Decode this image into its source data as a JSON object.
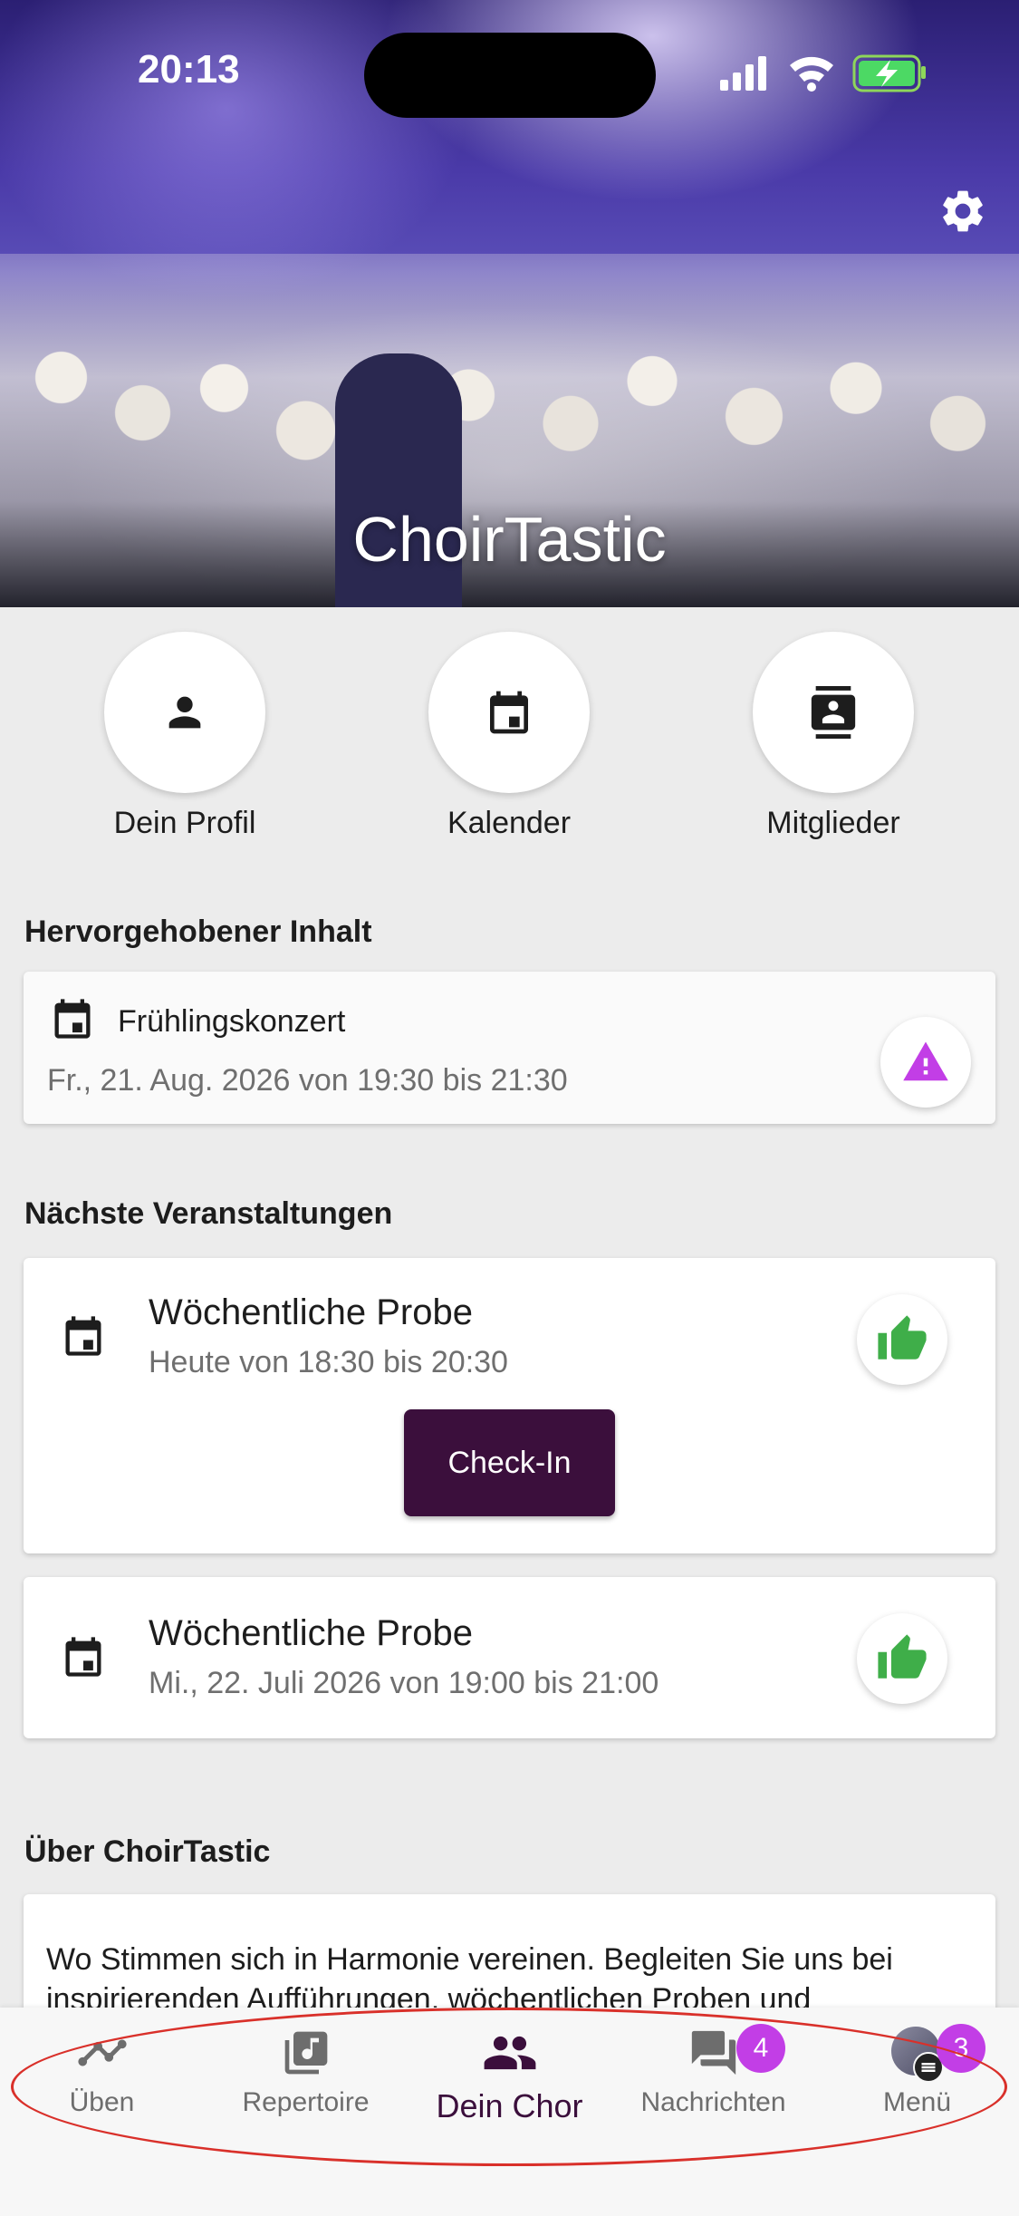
{
  "status_bar": {
    "time": "20:13"
  },
  "header": {
    "title": "ChoirTastic",
    "settings_icon": "gear-icon"
  },
  "quick_actions": [
    {
      "label": "Dein Profil",
      "icon": "person-icon"
    },
    {
      "label": "Kalender",
      "icon": "calendar-icon"
    },
    {
      "label": "Mitglieder",
      "icon": "contacts-icon"
    }
  ],
  "highlighted": {
    "section_title": "Hervorgehobener Inhalt",
    "event_title": "Frühlingskonzert",
    "event_time": "Fr., 21. Aug. 2026 von 19:30 bis 21:30",
    "status_icon": "warning-icon",
    "status_color": "#c23ee6"
  },
  "upcoming": {
    "section_title": "Nächste Veranstaltungen",
    "events": [
      {
        "title": "Wöchentliche Probe",
        "time": "Heute von 18:30 bis 20:30",
        "checkin_label": "Check-In",
        "status_icon": "thumbs-up-icon"
      },
      {
        "title": "Wöchentliche Probe",
        "time": "Mi., 22. Juli 2026 von 19:00 bis 21:00",
        "status_icon": "thumbs-up-icon"
      }
    ]
  },
  "about": {
    "section_title": "Über ChoirTastic",
    "text": "Wo Stimmen sich in Harmonie vereinen. Begleiten Sie uns bei inspirierenden Aufführungen, wöchentlichen Proben und"
  },
  "bottom_nav": {
    "items": [
      {
        "label": "Üben",
        "icon": "chart-line-icon"
      },
      {
        "label": "Repertoire",
        "icon": "music-note-icon"
      },
      {
        "label": "Dein Chor",
        "icon": "group-icon",
        "active": true
      },
      {
        "label": "Nachrichten",
        "icon": "chat-icon",
        "badge": "4"
      },
      {
        "label": "Menü",
        "icon": "avatar-icon",
        "badge": "3"
      }
    ]
  },
  "colors": {
    "accent": "#3b0f3c",
    "badge": "#c23ee6",
    "thumbs": "#3fae49",
    "annotation": "#d9302a"
  }
}
